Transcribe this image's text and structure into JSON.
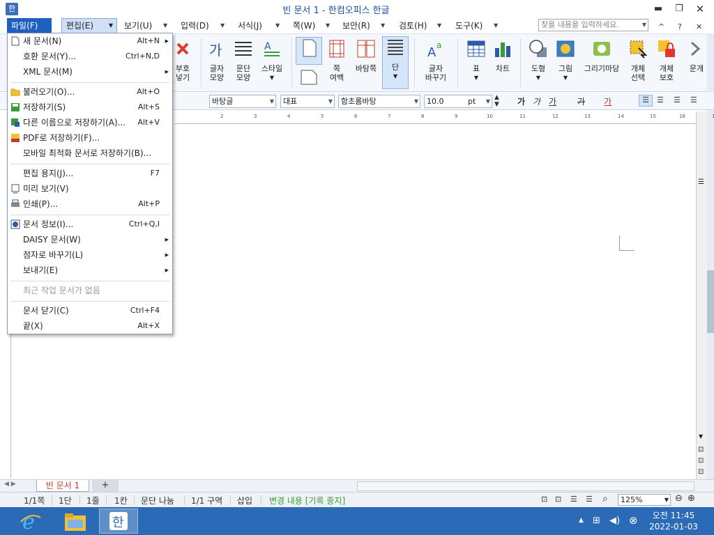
{
  "window": {
    "title": "빈 문서 1 - 한컴오피스 한글",
    "app_icon": "한",
    "minimize": "▬",
    "maximize": "❐",
    "close": "✕"
  },
  "menubar": {
    "items": [
      {
        "label": "파일(F)",
        "state": "active"
      },
      {
        "label": "편집(E)",
        "state": "selected"
      },
      {
        "label": "보기(U)"
      },
      {
        "label": "입력(D)"
      },
      {
        "label": "서식(J)"
      },
      {
        "label": "쪽(W)"
      },
      {
        "label": "보안(R)"
      },
      {
        "label": "검토(H)"
      },
      {
        "label": "도구(K)"
      }
    ],
    "search_placeholder": "찾을 내용을 입력하세요.",
    "right_controls": [
      "^",
      "?",
      "✕"
    ]
  },
  "ribbon": {
    "buttons": [
      {
        "label": "부호\n넣기",
        "icon": "symbol-icon"
      },
      {
        "label": "글자\n모양",
        "icon": "char-shape-icon"
      },
      {
        "label": "문단\n모양",
        "icon": "paragraph-shape-icon"
      },
      {
        "label": "스타일",
        "icon": "style-icon"
      },
      {
        "label": "",
        "icon": "page-icon"
      },
      {
        "label": "쪽\n여백",
        "icon": "page-margin-icon"
      },
      {
        "label": "바탕쪽",
        "icon": "master-page-icon"
      },
      {
        "label": "단",
        "icon": "columns-icon"
      },
      {
        "label": "글자\n바꾸기",
        "icon": "text-replace-icon"
      },
      {
        "label": "표",
        "icon": "table-icon"
      },
      {
        "label": "차트",
        "icon": "chart-icon"
      },
      {
        "label": "도형",
        "icon": "shape-icon"
      },
      {
        "label": "그림",
        "icon": "picture-icon"
      },
      {
        "label": "그리기마당",
        "icon": "clipart-icon"
      },
      {
        "label": "개체\n선택",
        "icon": "object-select-icon"
      },
      {
        "label": "개체\n보호",
        "icon": "object-protect-icon"
      },
      {
        "label": "문개",
        "icon": "more-icon"
      }
    ]
  },
  "format_toolbar": {
    "style": "바탕글",
    "lang": "대표",
    "font": "함초롬바탕",
    "size": "10.0",
    "unit": "pt",
    "bold": "가",
    "italic": "가",
    "underline": "가",
    "strike": "가",
    "color": "가"
  },
  "ruler": {
    "ticks": [
      "2",
      "3",
      "4",
      "5",
      "6",
      "7",
      "8",
      "9",
      "10",
      "11",
      "12",
      "13",
      "14",
      "15",
      "16",
      "17"
    ]
  },
  "file_menu": {
    "items": [
      {
        "label": "새 문서(N)",
        "shortcut": "Alt+N",
        "submenu": true,
        "icon": "new-doc-icon"
      },
      {
        "label": "호환 문서(Y)...",
        "shortcut": "Ctrl+N,D"
      },
      {
        "label": "XML 문서(M)",
        "submenu": true
      },
      {
        "sep": true
      },
      {
        "label": "불러오기(O)...",
        "shortcut": "Alt+O",
        "icon": "open-folder-icon"
      },
      {
        "label": "저장하기(S)",
        "shortcut": "Alt+S",
        "icon": "save-icon"
      },
      {
        "label": "다른 이름으로 저장하기(A)...",
        "shortcut": "Alt+V",
        "icon": "save-as-icon"
      },
      {
        "label": "PDF로 저장하기(F)...",
        "icon": "pdf-icon"
      },
      {
        "label": "모바일 최적화 문서로 저장하기(B)..."
      },
      {
        "sep": true
      },
      {
        "label": "편집 용지(J)...",
        "shortcut": "F7"
      },
      {
        "label": "미리 보기(V)",
        "icon": "preview-icon"
      },
      {
        "label": "인쇄(P)...",
        "shortcut": "Alt+P",
        "icon": "print-icon"
      },
      {
        "sep": true
      },
      {
        "label": "문서 정보(I)...",
        "shortcut": "Ctrl+Q,I",
        "icon": "info-icon"
      },
      {
        "label": "DAISY 문서(W)",
        "submenu": true
      },
      {
        "label": "점자로 바꾸기(L)",
        "submenu": true
      },
      {
        "label": "보내기(E)",
        "submenu": true
      },
      {
        "sep": true
      },
      {
        "label": "최근 작업 문서가 없음",
        "disabled": true
      },
      {
        "sep": true
      },
      {
        "label": "문서 닫기(C)",
        "shortcut": "Ctrl+F4"
      },
      {
        "label": "끝(X)",
        "shortcut": "Alt+X"
      }
    ]
  },
  "tabs": {
    "doc_tab": "빈 문서 1",
    "add_tab": "+"
  },
  "status": {
    "page": "1/1쪽",
    "column": "1단",
    "line": "1줄",
    "char": "1칸",
    "para_split": "문단 나눔",
    "section": "1/1 구역",
    "insert": "삽입",
    "track": "변경 내용 [기록 중지]",
    "zoom": "125%"
  },
  "taskbar": {
    "clock_time": "오전 11:45",
    "clock_date": "2022-01-03"
  },
  "colors": {
    "accent": "#1f5fbf",
    "title_text": "#1e4f9c",
    "taskbar": "#2a6ab6",
    "track_green": "#3a9a3a"
  }
}
